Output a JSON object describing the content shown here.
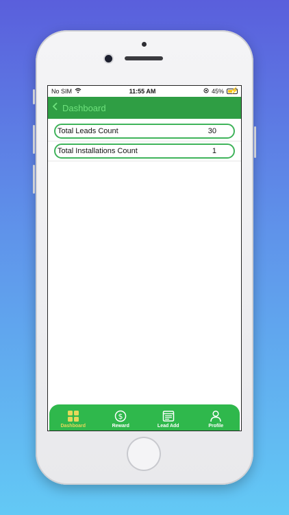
{
  "status_bar": {
    "carrier": "No SIM",
    "time": "11:55 AM",
    "battery": "45%"
  },
  "nav": {
    "title": "Dashboard"
  },
  "rows": [
    {
      "label": "Total Leads Count",
      "value": "30"
    },
    {
      "label": "Total Installations Count",
      "value": "1"
    }
  ],
  "tabs": [
    {
      "label": "Dashboard",
      "icon": "dashboard-grid-icon"
    },
    {
      "label": "Reward",
      "icon": "dollar-circle-icon"
    },
    {
      "label": "Lead Add",
      "icon": "form-icon"
    },
    {
      "label": "Profile",
      "icon": "person-icon"
    }
  ],
  "colors": {
    "primary": "#2f9e44",
    "tabbar": "#2fb84c",
    "accent": "#3fb35a",
    "active_tab": "#e6d85a"
  }
}
